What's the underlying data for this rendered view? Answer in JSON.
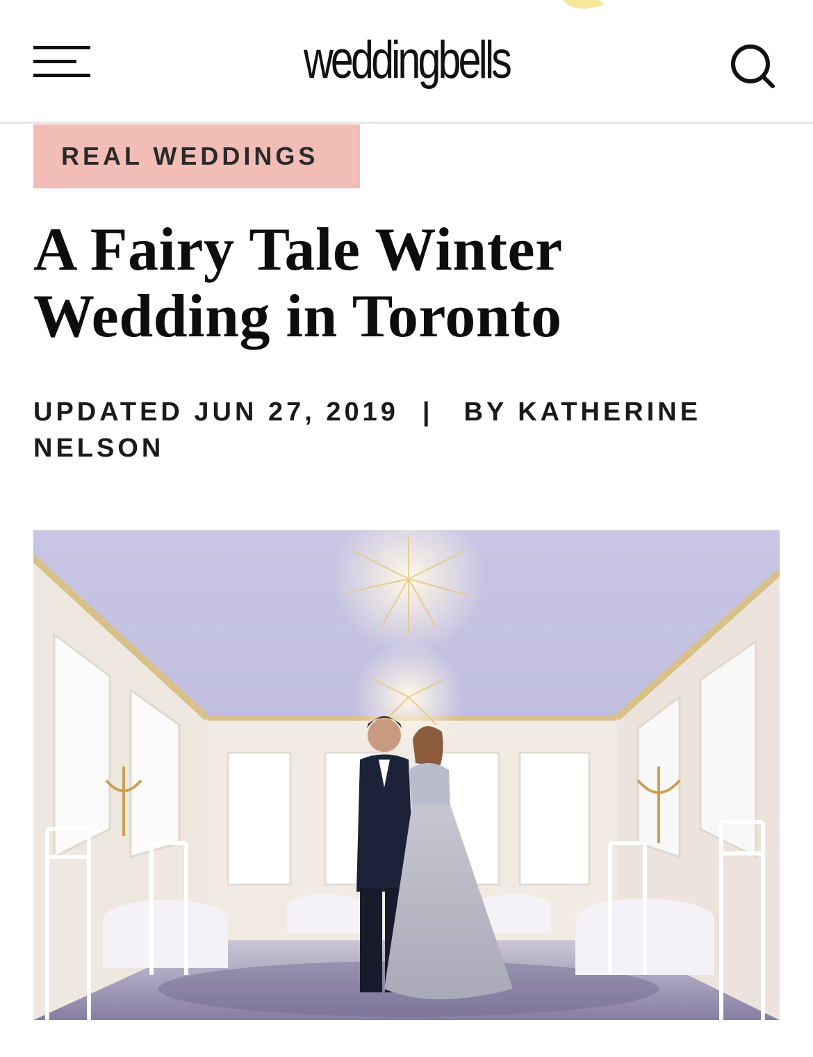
{
  "header": {
    "logo_text": "weddingbells",
    "menu_icon": "hamburger-menu-icon",
    "search_icon": "search-icon"
  },
  "article": {
    "category": "REAL WEDDINGS",
    "title_line1": "A Fairy Tale Winter",
    "title_line2": "Wedding in Toronto",
    "updated": "UPDATED JUN 27, 2019",
    "separator": "|",
    "author": "BY KATHERINE NELSON"
  },
  "hero_image": {
    "subject": "couple in a white ballroom with chandeliers"
  },
  "colors": {
    "badge_bg": "#f2bdb7",
    "text": "#111111",
    "divider": "#e6e6e6"
  }
}
